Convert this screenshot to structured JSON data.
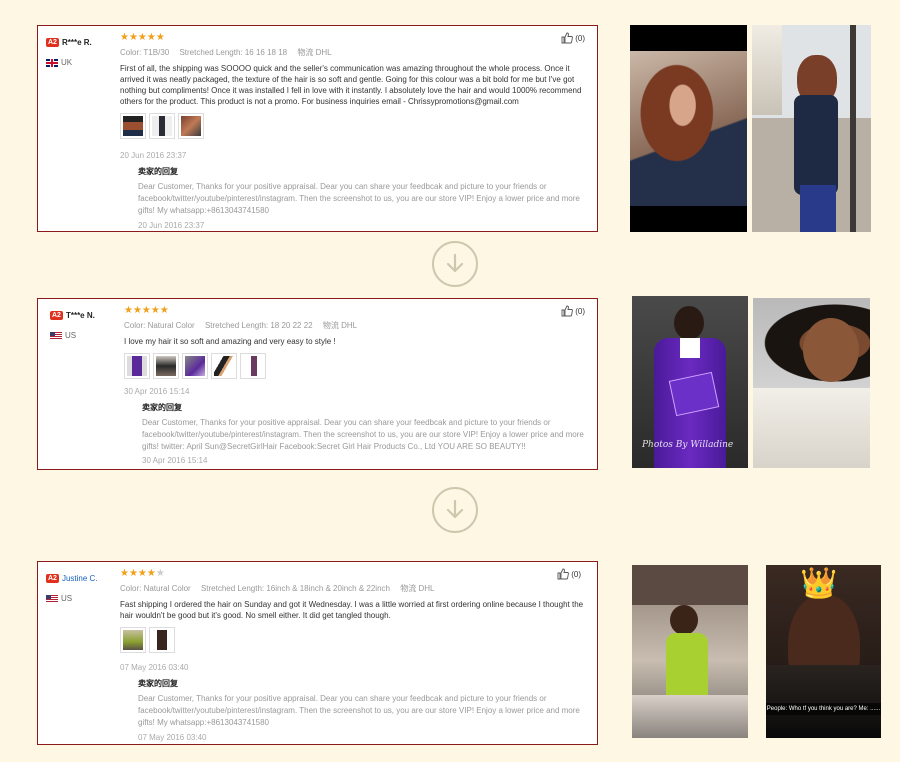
{
  "common": {
    "badge": "A2",
    "label_color": "Color:",
    "label_length": "Stretched Length:",
    "label_ship": "物流",
    "reply_title": "卖家的回复"
  },
  "reviews": [
    {
      "user": "R***e R.",
      "country": "UK",
      "stars": 5,
      "likes": "(0)",
      "color": "T1B/30",
      "length": "16 16 18 18",
      "shipping": "DHL",
      "text": "First of all, the shipping was SOOOO quick and the seller's communication was amazing throughout the whole process. Once it arrived it was neatly packaged, the texture of the hair is so soft and gentle. Going for this colour was a bit bold for me but I've got nothing but compliments! Once it was installed I fell in love with it instantly. I absolutely love the hair and would 1000% recommend others for the product. This product is not a promo. For business inquiries email - Chrissypromotions@gmail.com",
      "date": "20 Jun 2016 23:37",
      "reply": "Dear Customer, Thanks for your positive appraisal. Dear you can share your feedbcak and picture to your friends or facebook/twitter/youtube/pinterest/instagram. Then the screenshot to us, you are our store VIP! Enjoy a lower price and more gifts! My whatsapp:+8613043741580",
      "reply_date": "20 Jun 2016 23:37"
    },
    {
      "user": "T***e N.",
      "country": "US",
      "stars": 5,
      "likes": "(0)",
      "color": "Natural Color",
      "length": "18 20 22 22",
      "shipping": "DHL",
      "text": "I love my hair it so soft and amazing and very easy to style !",
      "date": "30 Apr 2016 15:14",
      "reply": "Dear Customer, Thanks for your positive appraisal. Dear you can share your feedbcak and picture to your friends or facebook/twitter/youtube/pinterest/instagram. Then the screenshot to us, you are our store VIP! Enjoy a lower price and more gifts! twitter: April Sun@SecretGirlHair Facebook:Secret Girl Hair Products Co., Ltd YOU ARE SO BEAUTY!!",
      "reply_date": "30 Apr 2016 15:14"
    },
    {
      "user": "Justine C.",
      "country": "US",
      "stars": 4,
      "likes": "(0)",
      "color": "Natural Color",
      "length": "16inch & 18inch & 20inch & 22inch",
      "shipping": "DHL",
      "text": "Fast shipping I ordered the hair on Sunday and got it Wednesday. I was a little worried at first ordering online because I thought the hair wouldn't be good but it's good. No smell either. It did get tangled though.",
      "date": "07 May 2016 03:40",
      "reply": "Dear Customer, Thanks for your positive appraisal. Dear you can share your feedbcak and picture to your friends or facebook/twitter/youtube/pinterest/instagram. Then the screenshot to us, you are our store VIP! Enjoy a lower price and more gifts! My whatsapp:+8613043741580",
      "reply_date": "07 May 2016 03:40"
    }
  ],
  "photo_texts": {
    "watermark": "Photos By Willadine",
    "caption": "People: Who tf you think you are? Me: ......"
  },
  "icons": {
    "thumbs_up": "thumbs-up-icon",
    "arrow_down": "arrow-down-circle-icon",
    "crown": "crown-icon"
  }
}
